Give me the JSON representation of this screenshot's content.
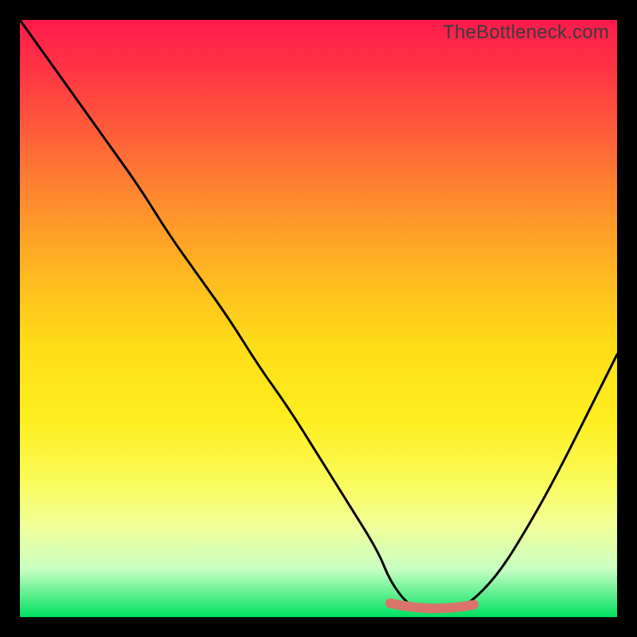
{
  "watermark": "TheBottleneck.com",
  "colors": {
    "background": "#000000",
    "curve": "#000000",
    "marker": "#d9736b",
    "gradient_top": "#ff1a4d",
    "gradient_bottom": "#00e060"
  },
  "chart_data": {
    "type": "line",
    "title": "",
    "xlabel": "",
    "ylabel": "",
    "xlim": [
      0,
      100
    ],
    "ylim": [
      0,
      100
    ],
    "series": [
      {
        "name": "bottleneck-curve",
        "x": [
          0,
          5,
          10,
          15,
          20,
          25,
          30,
          35,
          40,
          45,
          50,
          55,
          60,
          62,
          65,
          68,
          70,
          72,
          75,
          80,
          85,
          90,
          95,
          100
        ],
        "values": [
          100,
          93,
          86,
          79,
          72,
          64,
          57,
          50,
          42,
          35,
          27,
          19,
          11,
          6,
          2,
          1,
          1,
          1,
          2,
          7,
          15,
          24,
          34,
          44
        ]
      }
    ],
    "markers": [
      {
        "name": "optimum-flat-region",
        "x_range": [
          62,
          76
        ],
        "y": 1
      }
    ]
  }
}
